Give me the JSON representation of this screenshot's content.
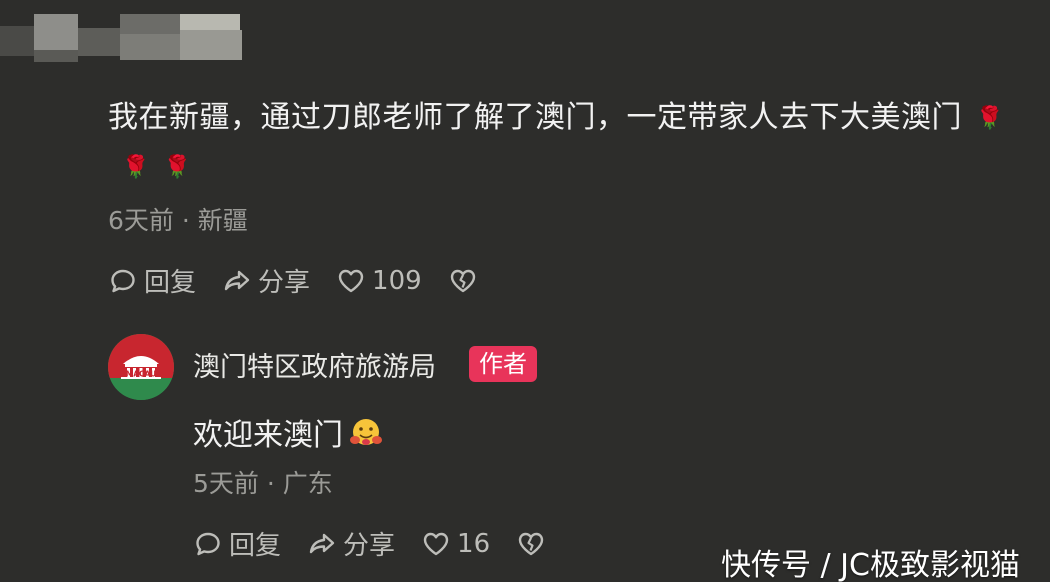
{
  "comment": {
    "text": "我在新疆，通过刀郎老师了解了澳门，一定带家人去下大美澳门",
    "emojis": [
      "🌹",
      "🌹",
      "🌹"
    ],
    "meta": "6天前 · 新疆",
    "actions": {
      "reply": "回复",
      "share": "分享",
      "likes": "109"
    }
  },
  "reply": {
    "author": "澳门特区政府旅游局",
    "badge": "作者",
    "avatar_text": "MACAU",
    "text": "欢迎来澳门",
    "meta": "5天前 · 广东",
    "actions": {
      "reply": "回复",
      "share": "分享",
      "likes": "16"
    }
  },
  "watermark": "快传号 / JC极致影视猫",
  "colors": {
    "background": "#2d2d2b",
    "badge": "#e8345a",
    "avatar_red": "#c8262f",
    "avatar_green": "#2f8a4c"
  }
}
